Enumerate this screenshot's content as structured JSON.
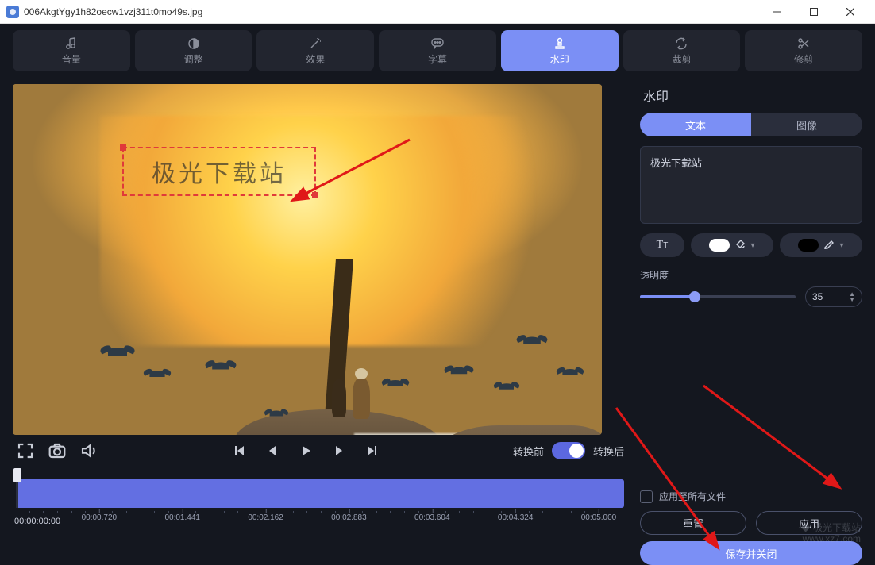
{
  "window": {
    "title": "006AkgtYgy1h82oecw1vzj311t0mo49s.jpg"
  },
  "tabs": [
    {
      "id": "volume",
      "label": "音量"
    },
    {
      "id": "adjust",
      "label": "调整"
    },
    {
      "id": "effect",
      "label": "效果"
    },
    {
      "id": "subtitle",
      "label": "字幕"
    },
    {
      "id": "watermark",
      "label": "水印",
      "active": true
    },
    {
      "id": "crop",
      "label": "裁剪"
    },
    {
      "id": "trim",
      "label": "修剪"
    }
  ],
  "preview": {
    "watermark_text": "极光下载站"
  },
  "player": {
    "before_label": "转换前",
    "after_label": "转换后",
    "toggle_after": true
  },
  "timeline": {
    "current": "00:00:00:00",
    "ticks": [
      "00:00.720",
      "00:01.441",
      "00:02.162",
      "00:02.883",
      "00:03.604",
      "00:04.324",
      "00:05.000"
    ]
  },
  "panel": {
    "title": "水印",
    "seg": {
      "text": "文本",
      "image": "图像"
    },
    "text_value": "极光下载站",
    "fill_color": "#ffffff",
    "stroke_color": "#000000",
    "opacity_label": "透明度",
    "opacity_value": "35",
    "opacity_percent": 35
  },
  "footer": {
    "apply_all": "应用至所有文件",
    "reset": "重置",
    "apply": "应用",
    "save_close": "保存并关闭"
  },
  "brand": {
    "line1": "◆ 极光下载站",
    "line2": "www.xz7.com"
  }
}
